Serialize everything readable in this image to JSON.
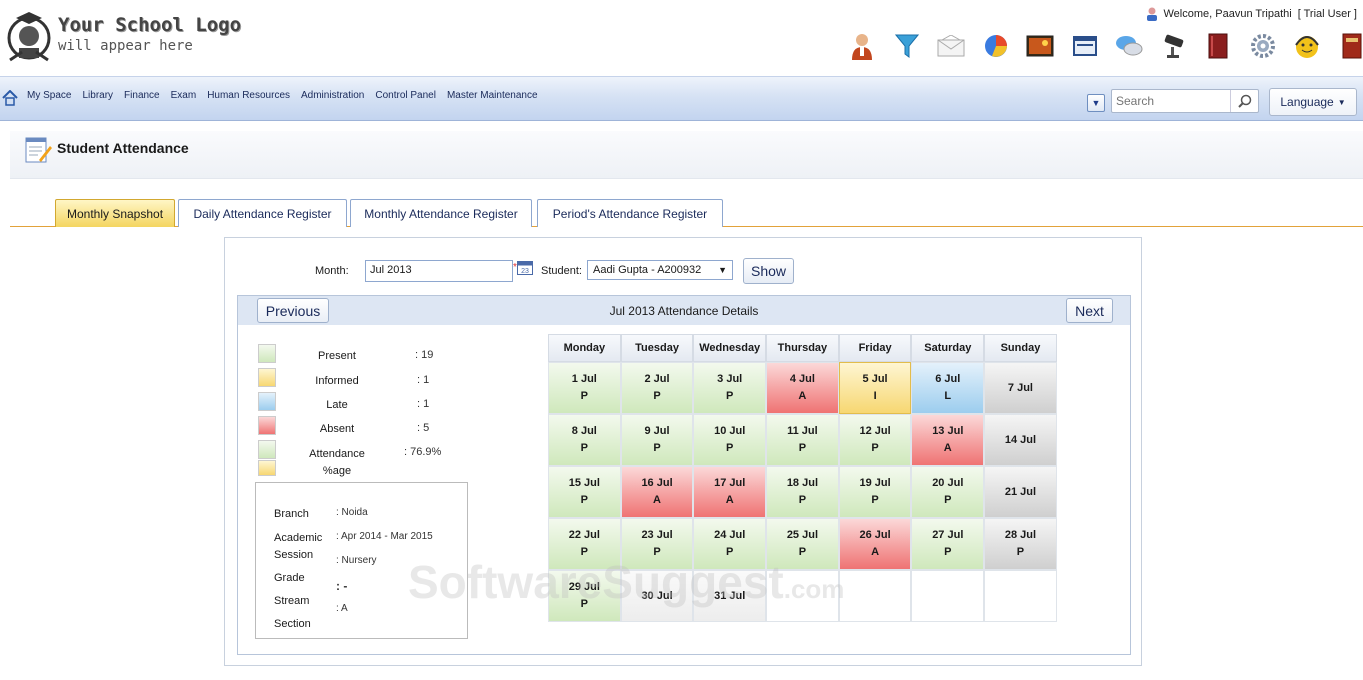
{
  "logo": {
    "line1": "Your School Logo",
    "line2": "will appear here"
  },
  "user": {
    "welcome": "Welcome, Paavun Tripathi",
    "tag": "[ Trial User ]"
  },
  "toolbar_icons": [
    "user-icon",
    "filter-icon",
    "mail-icon",
    "pie-chart-icon",
    "picture-icon",
    "calendar-window-icon",
    "chat-icon",
    "cctv-icon",
    "book-icon",
    "settings-icon",
    "support-icon",
    "library-book-icon"
  ],
  "nav": {
    "items": [
      "My Space",
      "Library",
      "Finance",
      "Exam",
      "Human Resources",
      "Administration",
      "Control Panel",
      "Master Maintenance"
    ],
    "search_placeholder": "Search",
    "language": "Language"
  },
  "page": {
    "title": "Student Attendance"
  },
  "tabs": [
    "Monthly Snapshot",
    "Daily Attendance Register",
    "Monthly Attendance Register",
    "Period's Attendance Register"
  ],
  "form": {
    "month_label": "Month:",
    "month_value": "Jul 2013",
    "student_label": "Student:",
    "student_value": "Aadi Gupta - A200932",
    "show": "Show"
  },
  "details": {
    "prev": "Previous",
    "next": "Next",
    "title": "Jul 2013 Attendance Details"
  },
  "legend": [
    {
      "label": "Present",
      "value": ": 19",
      "color": "#d6ecc6"
    },
    {
      "label": "Informed",
      "value": ": 1",
      "color": "#f7d772"
    },
    {
      "label": "Late",
      "value": ": 1",
      "color": "#9ccdee"
    },
    {
      "label": "Absent",
      "value": ": 5",
      "color": "#ef7373"
    },
    {
      "label": "Attendance",
      "label2": "%age",
      "value": ": 76.9%"
    }
  ],
  "info": {
    "labels": [
      "Branch",
      "Academic",
      "Session",
      "Grade",
      "Stream",
      "Section"
    ],
    "branch": ": Noida",
    "session": ": Apr 2014 - Mar 2015",
    "grade": ": Nursery",
    "stream": ": -",
    "section": ": A"
  },
  "weekdays": [
    "Monday",
    "Tuesday",
    "Wednesday",
    "Thursday",
    "Friday",
    "Saturday",
    "Sunday"
  ],
  "calendar": [
    {
      "d": "1 Jul",
      "s": "P"
    },
    {
      "d": "2 Jul",
      "s": "P"
    },
    {
      "d": "3 Jul",
      "s": "P"
    },
    {
      "d": "4 Jul",
      "s": "A"
    },
    {
      "d": "5 Jul",
      "s": "I"
    },
    {
      "d": "6 Jul",
      "s": "L"
    },
    {
      "d": "7 Jul",
      "s": ""
    },
    {
      "d": "8 Jul",
      "s": "P"
    },
    {
      "d": "9 Jul",
      "s": "P"
    },
    {
      "d": "10 Jul",
      "s": "P"
    },
    {
      "d": "11 Jul",
      "s": "P"
    },
    {
      "d": "12 Jul",
      "s": "P"
    },
    {
      "d": "13 Jul",
      "s": "A"
    },
    {
      "d": "14 Jul",
      "s": ""
    },
    {
      "d": "15 Jul",
      "s": "P"
    },
    {
      "d": "16 Jul",
      "s": "A"
    },
    {
      "d": "17 Jul",
      "s": "A"
    },
    {
      "d": "18 Jul",
      "s": "P"
    },
    {
      "d": "19 Jul",
      "s": "P"
    },
    {
      "d": "20 Jul",
      "s": "P"
    },
    {
      "d": "21 Jul",
      "s": ""
    },
    {
      "d": "22 Jul",
      "s": "P"
    },
    {
      "d": "23 Jul",
      "s": "P"
    },
    {
      "d": "24 Jul",
      "s": "P"
    },
    {
      "d": "25 Jul",
      "s": "P"
    },
    {
      "d": "26 Jul",
      "s": "A"
    },
    {
      "d": "27 Jul",
      "s": "P"
    },
    {
      "d": "28 Jul",
      "s": "P"
    },
    {
      "d": "29 Jul",
      "s": "P"
    },
    {
      "d": "30 Jul",
      "s": ""
    },
    {
      "d": "31 Jul",
      "s": ""
    },
    {
      "d": "",
      "s": ""
    },
    {
      "d": "",
      "s": ""
    },
    {
      "d": "",
      "s": ""
    },
    {
      "d": "",
      "s": ""
    }
  ],
  "watermark": {
    "main": "SoftwareSuggest",
    "suffix": ".com"
  }
}
